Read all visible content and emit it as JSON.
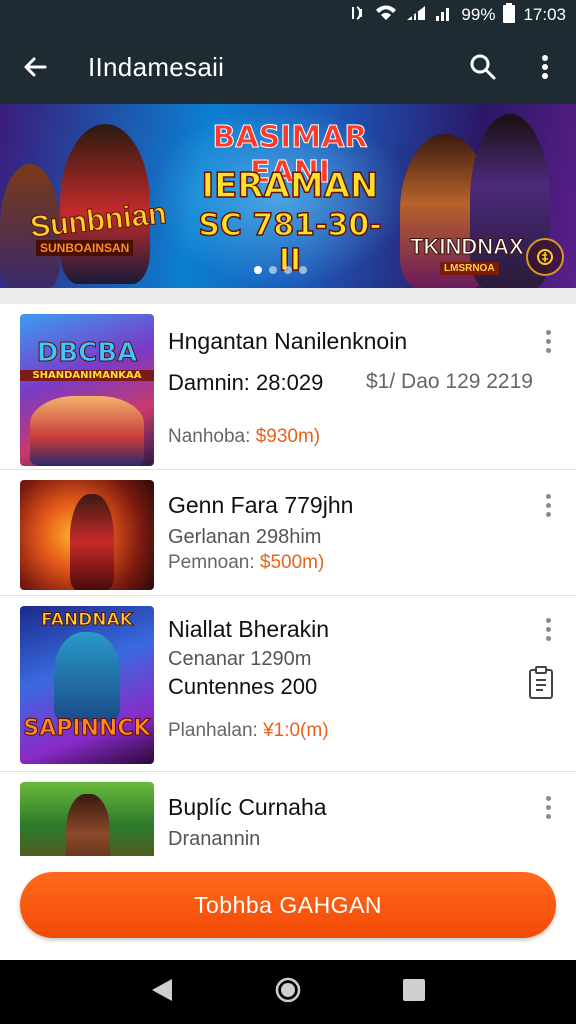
{
  "status_bar": {
    "icons": [
      "nfc-icon",
      "wifi-icon",
      "network-icon",
      "signal-icon",
      "battery-icon"
    ],
    "battery": "99%",
    "time": "17:03"
  },
  "app_bar": {
    "title": "IIndamesaii",
    "back_icon": "arrow-left-icon",
    "search_icon": "search-icon",
    "menu_icon": "more-vert-icon",
    "background": "#1e2b33"
  },
  "banner": {
    "line1": "BASIMAR EANI",
    "line2": "IERAMAN",
    "line3": "SC 781-30-II",
    "left_logo": "Sunbnian",
    "left_logo_sub": "SUNBOAINSAN",
    "right_logo": "TKINDNAX",
    "right_logo_sub": "LMSRNOA",
    "slide_count": 4,
    "active_slide": 1,
    "coin_icon": "coin-icon"
  },
  "games": [
    {
      "thumb_title": "DBCBA",
      "thumb_sub": "SHANDANIMANKAA",
      "title": "Hngantan Nanilenknoin",
      "line2": "Damnin: 28:029",
      "extra": "$1/ Dao 129 2219",
      "line3_label": "Nanhoba: ",
      "line3_price": "$930m)"
    },
    {
      "thumb_title": "",
      "thumb_sub": "",
      "title": "Genn Fara 779jhn",
      "line2": "Gerlanan 298him",
      "extra": "",
      "line3_label": "Pemnoan: ",
      "line3_price": "$500m)"
    },
    {
      "thumb_title": "FANDNAK",
      "thumb_sub": "SAPINNCK",
      "title": "Niallat Bherakin",
      "line2": "Cenanar 1290m",
      "line2b": "Cuntennes 200",
      "extra": "",
      "line3_label": "Planhalan: ",
      "line3_price": "¥1:0(m)"
    },
    {
      "thumb_title": "",
      "thumb_sub": "",
      "title": "Buplíc Curnaha",
      "line2": "Dranannin",
      "extra": "",
      "line3_label": "",
      "line3_price": ""
    }
  ],
  "cta": {
    "label": "Tobhba GAHGAN",
    "color": "#f4520a"
  },
  "nav": {
    "back_icon": "nav-back-icon",
    "home_icon": "nav-home-icon",
    "recents_icon": "nav-recents-icon"
  }
}
